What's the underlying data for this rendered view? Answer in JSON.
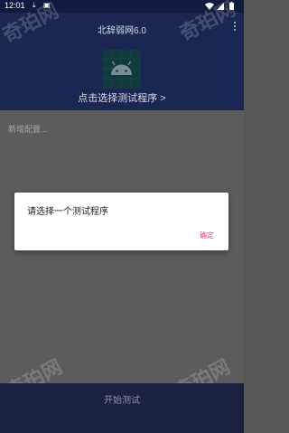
{
  "status_bar": {
    "time": "12:01",
    "icons_left": [
      "download-icon",
      "notification-icon"
    ],
    "icons_right": [
      "wifi-icon",
      "cellular-signal-icon",
      "battery-icon"
    ]
  },
  "header": {
    "title": "北辞弱网6.0",
    "select_program_label": "点击选择测试程序 >"
  },
  "config": {
    "placeholder": "新增配置..."
  },
  "dialog": {
    "message": "请选择一个测试程序",
    "confirm_label": "确定"
  },
  "bottom": {
    "start_label": "开始测试"
  },
  "watermark": {
    "text": "奇珀网"
  },
  "colors": {
    "header_bg": "#1b2753",
    "status_bg": "#111a3f",
    "bottom_bg": "#1a2141",
    "content_bg": "#5c5c5c",
    "accent": "#e5477a",
    "android_green": "#3ddc84"
  }
}
